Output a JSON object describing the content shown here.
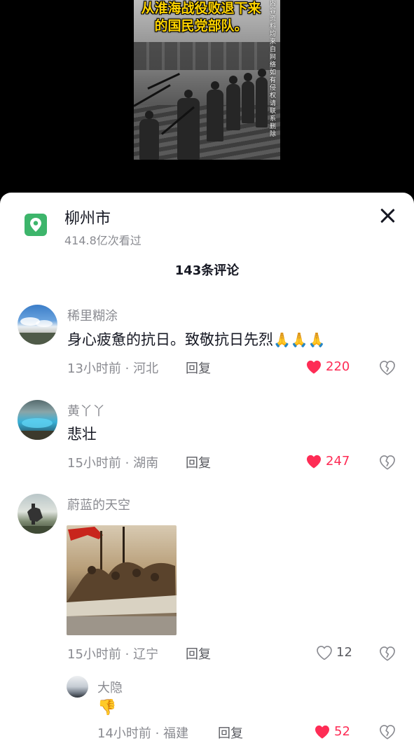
{
  "video": {
    "caption": "从淮海战役败退下来的国民党部队。",
    "disclaimer": "内容资料均来自网络如有侵权请联系删除"
  },
  "sheet": {
    "location_name": "柳州市",
    "location_views": "414.8亿次看过",
    "comment_count": "143条评论"
  },
  "comments": [
    {
      "user": "稀里糊涂",
      "text": "身心疲惫的抗日。致敬抗日先烈",
      "emoji": "🙏🙏🙏",
      "meta": "13小时前 · 河北",
      "reply_label": "回复",
      "likes": "220",
      "liked": true
    },
    {
      "user": "黄丫丫",
      "text": "悲壮",
      "meta": "15小时前 · 湖南",
      "reply_label": "回复",
      "likes": "247",
      "liked": true
    },
    {
      "user": "蔚蓝的天空",
      "meta": "15小时前 · 辽宁",
      "reply_label": "回复",
      "likes": "12",
      "liked": false
    }
  ],
  "reply": {
    "user": "大隐",
    "emoji": "👎",
    "meta": "14小时前 · 福建",
    "reply_label": "回复",
    "likes": "52",
    "liked": true
  },
  "colors": {
    "like_red": "#fe2c55",
    "location_green": "#3db56b",
    "caption_yellow": "#ffd400"
  }
}
